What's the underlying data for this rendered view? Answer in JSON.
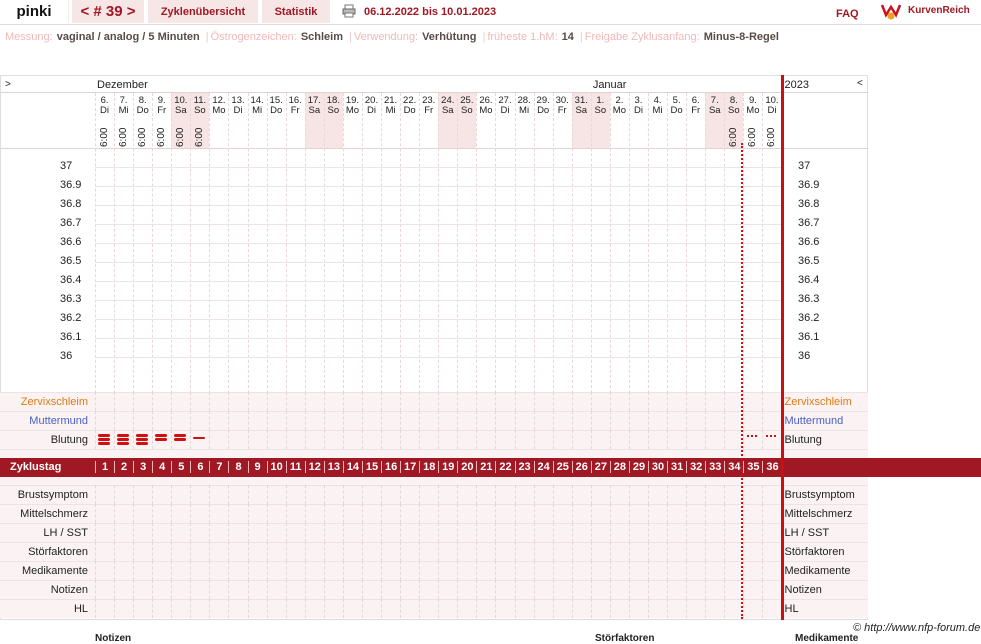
{
  "header": {
    "user": "pinki",
    "cycle": "< # 39 >",
    "tab_overview": "Zyklenübersicht",
    "tab_stats": "Statistik",
    "date_range": "06.12.2022 bis 10.01.2023",
    "faq": "FAQ",
    "logo": "KurvenReich"
  },
  "info": [
    {
      "label": "Messung:",
      "value": "vaginal / analog / 5 Minuten"
    },
    {
      "label": "Östrogenzeichen:",
      "value": "Schleim"
    },
    {
      "label": "Verwendung:",
      "value": "Verhütung"
    },
    {
      "label": "früheste 1.hM:",
      "value": "14"
    },
    {
      "label": "Freigabe Zyklusanfang:",
      "value": "Minus-8-Regel"
    }
  ],
  "chart": {
    "nav_left": ">",
    "nav_right": "<",
    "months": [
      {
        "name": "Dezember",
        "day_index": 0
      },
      {
        "name": "Januar",
        "day_index": 26
      }
    ],
    "year": "2023",
    "days": [
      {
        "d": "6.",
        "w": "Di",
        "t": "6:00",
        "we": false
      },
      {
        "d": "7.",
        "w": "Mi",
        "t": "6:00",
        "we": false
      },
      {
        "d": "8.",
        "w": "Do",
        "t": "6:00",
        "we": false
      },
      {
        "d": "9.",
        "w": "Fr",
        "t": "6:00",
        "we": false
      },
      {
        "d": "10.",
        "w": "Sa",
        "t": "6:00",
        "we": true
      },
      {
        "d": "11.",
        "w": "So",
        "t": "6:00",
        "we": true
      },
      {
        "d": "12.",
        "w": "Mo",
        "t": "",
        "we": false
      },
      {
        "d": "13.",
        "w": "Di",
        "t": "",
        "we": false
      },
      {
        "d": "14.",
        "w": "Mi",
        "t": "",
        "we": false
      },
      {
        "d": "15.",
        "w": "Do",
        "t": "",
        "we": false
      },
      {
        "d": "16.",
        "w": "Fr",
        "t": "",
        "we": false
      },
      {
        "d": "17.",
        "w": "Sa",
        "t": "",
        "we": true
      },
      {
        "d": "18.",
        "w": "So",
        "t": "",
        "we": true
      },
      {
        "d": "19.",
        "w": "Mo",
        "t": "",
        "we": false
      },
      {
        "d": "20.",
        "w": "Di",
        "t": "",
        "we": false
      },
      {
        "d": "21.",
        "w": "Mi",
        "t": "",
        "we": false
      },
      {
        "d": "22.",
        "w": "Do",
        "t": "",
        "we": false
      },
      {
        "d": "23.",
        "w": "Fr",
        "t": "",
        "we": false
      },
      {
        "d": "24.",
        "w": "Sa",
        "t": "",
        "we": true
      },
      {
        "d": "25.",
        "w": "So",
        "t": "",
        "we": true
      },
      {
        "d": "26.",
        "w": "Mo",
        "t": "",
        "we": false
      },
      {
        "d": "27.",
        "w": "Di",
        "t": "",
        "we": false
      },
      {
        "d": "28.",
        "w": "Mi",
        "t": "",
        "we": false
      },
      {
        "d": "29.",
        "w": "Do",
        "t": "",
        "we": false
      },
      {
        "d": "30.",
        "w": "Fr",
        "t": "",
        "we": false
      },
      {
        "d": "31.",
        "w": "Sa",
        "t": "",
        "we": true
      },
      {
        "d": "1.",
        "w": "So",
        "t": "",
        "we": true
      },
      {
        "d": "2.",
        "w": "Mo",
        "t": "",
        "we": false
      },
      {
        "d": "3.",
        "w": "Di",
        "t": "",
        "we": false
      },
      {
        "d": "4.",
        "w": "Mi",
        "t": "",
        "we": false
      },
      {
        "d": "5.",
        "w": "Do",
        "t": "",
        "we": false
      },
      {
        "d": "6.",
        "w": "Fr",
        "t": "",
        "we": false
      },
      {
        "d": "7.",
        "w": "Sa",
        "t": "",
        "we": true
      },
      {
        "d": "8.",
        "w": "So",
        "t": "6:00",
        "we": true
      },
      {
        "d": "9.",
        "w": "Mo",
        "t": "6:00",
        "we": false
      },
      {
        "d": "10.",
        "w": "Di",
        "t": "6:00",
        "we": false
      }
    ],
    "temps": [
      "37",
      "36.9",
      "36.8",
      "36.7",
      "36.6",
      "36.5",
      "36.4",
      "36.3",
      "36.2",
      "36.1",
      "36"
    ],
    "row_labels": {
      "zervix": "Zervixschleim",
      "muttermund": "Muttermund",
      "blutung": "Blutung",
      "zyklustag": "Zyklustag",
      "brust": "Brustsymptom",
      "mittel": "Mittelschmerz",
      "lh": "LH / SST",
      "stoer": "Störfaktoren",
      "medi": "Medikamente",
      "notizen": "Notizen",
      "hl": "HL"
    },
    "bleeding": [
      3,
      3,
      3,
      2,
      2,
      1,
      0,
      0,
      0,
      0,
      0,
      0,
      0,
      0,
      0,
      0,
      0,
      0,
      0,
      0,
      0,
      0,
      0,
      0,
      0,
      0,
      0,
      0,
      0,
      0,
      0,
      0,
      0,
      0,
      "s",
      "s"
    ],
    "cycle_days": [
      "1",
      "2",
      "3",
      "4",
      "5",
      "6",
      "7",
      "8",
      "9",
      "10",
      "11",
      "12",
      "13",
      "14",
      "15",
      "16",
      "17",
      "18",
      "19",
      "20",
      "21",
      "22",
      "23",
      "24",
      "25",
      "26",
      "27",
      "28",
      "29",
      "30",
      "31",
      "32",
      "33",
      "34",
      "35",
      "36"
    ],
    "colors": {
      "accent": "#a01824",
      "weekend": "#f7e4e4",
      "zervix": "#e07a10",
      "muttermund": "#4a5ec8"
    }
  },
  "footer": {
    "copyright": "© http://www.nfp-forum.de",
    "bottom_left": "Notizen",
    "bottom_mid": "Störfaktoren",
    "bottom_right": "Medikamente"
  }
}
